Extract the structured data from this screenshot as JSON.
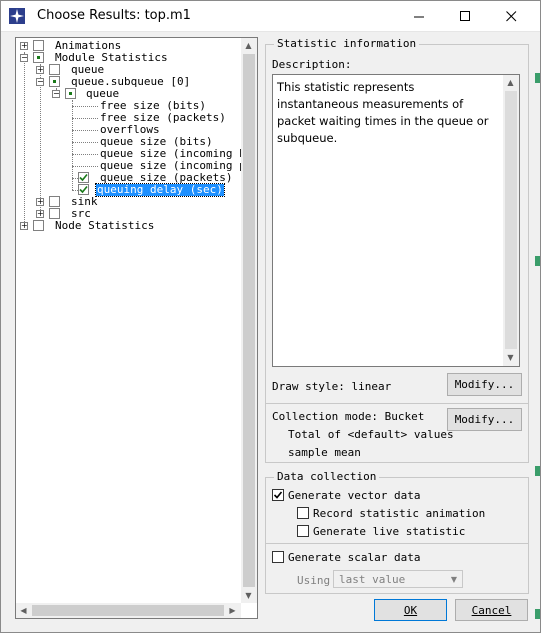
{
  "window": {
    "title": "Choose Results: top.m1",
    "controls": {
      "minimize": "—",
      "maximize": "☐",
      "close": "✕"
    }
  },
  "tree": {
    "rows": [
      {
        "label": "Animations",
        "check": "empty",
        "expander": "+"
      },
      {
        "label": "Module Statistics",
        "check": "partial",
        "expander": "−"
      },
      {
        "label": "queue",
        "check": "empty",
        "expander": "+"
      },
      {
        "label": "queue.subqueue [0]",
        "check": "partial",
        "expander": "−"
      },
      {
        "label": "queue",
        "check": "partial",
        "expander": "−"
      },
      {
        "label": "free size (bits)",
        "check": "none"
      },
      {
        "label": "free size (packets)",
        "check": "none"
      },
      {
        "label": "overflows",
        "check": "none"
      },
      {
        "label": "queue size (bits)",
        "check": "none"
      },
      {
        "label": "queue size (incoming bit",
        "check": "none"
      },
      {
        "label": "queue size (incoming pac",
        "check": "none"
      },
      {
        "label": "queue size (packets)",
        "check": "checked"
      },
      {
        "label": "queuing delay (sec)",
        "check": "checked",
        "selected": true
      },
      {
        "label": "sink",
        "check": "empty",
        "expander": "+"
      },
      {
        "label": "src",
        "check": "empty",
        "expander": "+"
      },
      {
        "label": "Node Statistics",
        "check": "empty",
        "expander": "+"
      }
    ]
  },
  "stat_info": {
    "legend": "Statistic information",
    "description_label": "Description:",
    "description": "This statistic represents instantaneous measurements of packet waiting times in the queue or subqueue.",
    "draw_style": "Draw style: linear",
    "modify_label": "Modify...",
    "collection_mode": "Collection mode: Bucket",
    "total_of": "Total of <default> values",
    "sample_mean": "sample mean"
  },
  "data_collection": {
    "legend": "Data collection",
    "generate_vector": {
      "label": "Generate vector data",
      "checked": true
    },
    "record_animation": {
      "label": "Record statistic animation",
      "checked": false
    },
    "generate_live": {
      "label": "Generate live statistic",
      "checked": false
    },
    "generate_scalar": {
      "label": "Generate scalar data",
      "checked": false
    },
    "using_label": "Using",
    "using_value": "last value"
  },
  "buttons": {
    "ok": "OK",
    "cancel": "Cancel"
  },
  "colors": {
    "selection": "#1e90ff",
    "check_green": "#1a7a1a",
    "default_button_border": "#0078d7"
  }
}
